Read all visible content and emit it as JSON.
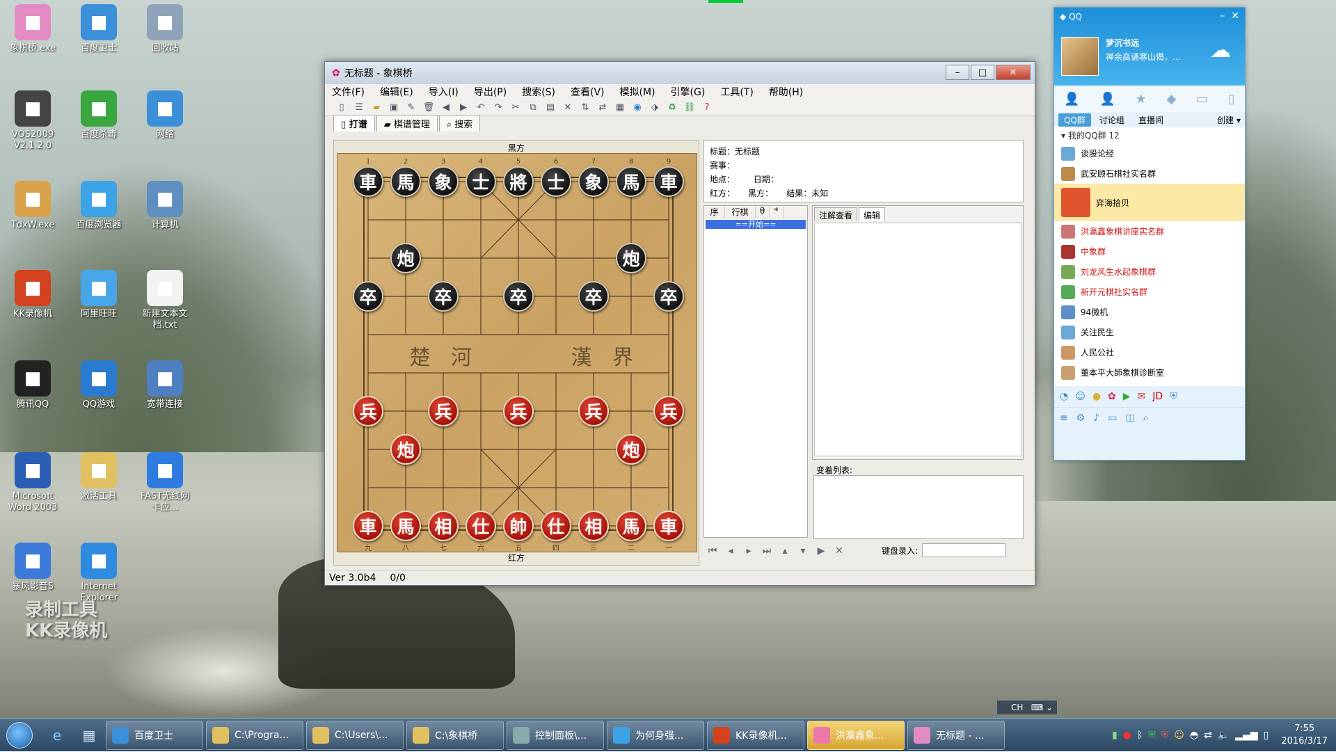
{
  "desktop": {
    "icons": [
      {
        "label": "象棋桥.exe",
        "icon": "cherry-blossom",
        "color": "#e58bc4"
      },
      {
        "label": "百度卫士",
        "icon": "shield",
        "color": "#3c8fd9"
      },
      {
        "label": "回收站",
        "icon": "recycle-bin",
        "color": "#8fa3b8"
      },
      {
        "label": "VOS2009\nV2.1.2.0",
        "icon": "vos",
        "color": "#444"
      },
      {
        "label": "百度杀毒",
        "icon": "shield-green",
        "color": "#3aa640"
      },
      {
        "label": "网络",
        "icon": "globe",
        "color": "#3c8fd9"
      },
      {
        "label": "TdxW.exe",
        "icon": "tdx",
        "color": "#d9a24a"
      },
      {
        "label": "百度浏览器",
        "icon": "browser",
        "color": "#3ba3e6"
      },
      {
        "label": "计算机",
        "icon": "computer",
        "color": "#5f8fc0"
      },
      {
        "label": "KK录像机",
        "icon": "kk",
        "color": "#d2421e"
      },
      {
        "label": "阿里旺旺",
        "icon": "wangwang",
        "color": "#48a6e8"
      },
      {
        "label": "新建文本文\n档.txt",
        "icon": "text-file",
        "color": "#f2f2f2"
      },
      {
        "label": "腾讯QQ",
        "icon": "penguin",
        "color": "#222"
      },
      {
        "label": "QQ游戏",
        "icon": "penguin-game",
        "color": "#2a7ad0"
      },
      {
        "label": "宽带连接",
        "icon": "network",
        "color": "#4e7fc0"
      },
      {
        "label": "Microsoft\nWord 2003",
        "icon": "word",
        "color": "#2a5eb5"
      },
      {
        "label": "激活工具",
        "icon": "folder",
        "color": "#e0c060"
      },
      {
        "label": "FAST无线网\n卡应...",
        "icon": "bars",
        "color": "#2f7be0"
      },
      {
        "label": "暴风影音5",
        "icon": "storm",
        "color": "#3b7ad8"
      },
      {
        "label": "Internet\nExplorer",
        "icon": "ie",
        "color": "#2f8be0"
      }
    ],
    "watermark": "录制工具\nKK录像机"
  },
  "window": {
    "title": "无标题 - 象棋桥",
    "menus": [
      "文件(F)",
      "编辑(E)",
      "导入(I)",
      "导出(P)",
      "搜索(S)",
      "查看(V)",
      "模拟(M)",
      "引擎(G)",
      "工具(T)",
      "帮助(H)"
    ],
    "tabs": [
      "打谱",
      "棋谱管理",
      "搜索"
    ],
    "board": {
      "top_label": "黑方",
      "bottom_label": "红方",
      "river_left": "楚 河",
      "river_right": "漢 界",
      "top_numbers": [
        "1",
        "2",
        "3",
        "4",
        "5",
        "6",
        "7",
        "8",
        "9"
      ],
      "bottom_numbers": [
        "九",
        "八",
        "七",
        "六",
        "五",
        "四",
        "三",
        "二",
        "一"
      ],
      "pieces": [
        {
          "c": 0,
          "r": 0,
          "t": "車",
          "s": "black"
        },
        {
          "c": 1,
          "r": 0,
          "t": "馬",
          "s": "black"
        },
        {
          "c": 2,
          "r": 0,
          "t": "象",
          "s": "black"
        },
        {
          "c": 3,
          "r": 0,
          "t": "士",
          "s": "black"
        },
        {
          "c": 4,
          "r": 0,
          "t": "將",
          "s": "black"
        },
        {
          "c": 5,
          "r": 0,
          "t": "士",
          "s": "black"
        },
        {
          "c": 6,
          "r": 0,
          "t": "象",
          "s": "black"
        },
        {
          "c": 7,
          "r": 0,
          "t": "馬",
          "s": "black"
        },
        {
          "c": 8,
          "r": 0,
          "t": "車",
          "s": "black"
        },
        {
          "c": 1,
          "r": 2,
          "t": "炮",
          "s": "black"
        },
        {
          "c": 7,
          "r": 2,
          "t": "炮",
          "s": "black"
        },
        {
          "c": 0,
          "r": 3,
          "t": "卒",
          "s": "black"
        },
        {
          "c": 2,
          "r": 3,
          "t": "卒",
          "s": "black"
        },
        {
          "c": 4,
          "r": 3,
          "t": "卒",
          "s": "black"
        },
        {
          "c": 6,
          "r": 3,
          "t": "卒",
          "s": "black"
        },
        {
          "c": 8,
          "r": 3,
          "t": "卒",
          "s": "black"
        },
        {
          "c": 0,
          "r": 6,
          "t": "兵",
          "s": "red"
        },
        {
          "c": 2,
          "r": 6,
          "t": "兵",
          "s": "red"
        },
        {
          "c": 4,
          "r": 6,
          "t": "兵",
          "s": "red"
        },
        {
          "c": 6,
          "r": 6,
          "t": "兵",
          "s": "red"
        },
        {
          "c": 8,
          "r": 6,
          "t": "兵",
          "s": "red"
        },
        {
          "c": 1,
          "r": 7,
          "t": "炮",
          "s": "red"
        },
        {
          "c": 7,
          "r": 7,
          "t": "炮",
          "s": "red"
        },
        {
          "c": 0,
          "r": 9,
          "t": "車",
          "s": "red"
        },
        {
          "c": 1,
          "r": 9,
          "t": "馬",
          "s": "red"
        },
        {
          "c": 2,
          "r": 9,
          "t": "相",
          "s": "red"
        },
        {
          "c": 3,
          "r": 9,
          "t": "仕",
          "s": "red"
        },
        {
          "c": 4,
          "r": 9,
          "t": "帥",
          "s": "red"
        },
        {
          "c": 5,
          "r": 9,
          "t": "仕",
          "s": "red"
        },
        {
          "c": 6,
          "r": 9,
          "t": "相",
          "s": "red"
        },
        {
          "c": 7,
          "r": 9,
          "t": "馬",
          "s": "red"
        },
        {
          "c": 8,
          "r": 9,
          "t": "車",
          "s": "red"
        }
      ]
    },
    "info": {
      "title": "标题：无标题",
      "event": "赛事：",
      "place": "地点：",
      "date": "日期：",
      "red": "红方：",
      "black": "黑方：",
      "result": "结果：未知"
    },
    "movelist": {
      "headers": [
        "序",
        "行棋",
        "θ",
        "*"
      ],
      "rows": [
        "==开始=="
      ]
    },
    "note_tabs": [
      "注解查看",
      "编辑"
    ],
    "variations_label": "变着列表:",
    "keyboard_label": "键盘录入:",
    "status": {
      "version": "Ver 3.0b4",
      "count": "0/0"
    }
  },
  "qq": {
    "title": "QQ",
    "nickname": "梦沉书远",
    "signature": "禅余高诵寒山偈，...",
    "tabs": [
      "QQ群",
      "讨论组",
      "直播间"
    ],
    "create": "创建",
    "group_header": "我的QQ群 12",
    "groups": [
      {
        "name": "谈股论经",
        "red": false,
        "color": "#6aa8d6"
      },
      {
        "name": "武安顾石棋社实名群",
        "red": false,
        "color": "#b98a4a"
      },
      {
        "name": "弈海拾贝",
        "red": false,
        "color": "#e0552d",
        "highlight": true
      },
      {
        "name": "洪瀛鑫象棋讲座实名群",
        "red": true,
        "color": "#c77"
      },
      {
        "name": "中象群",
        "red": true,
        "color": "#a33"
      },
      {
        "name": "刘龙风生水起象棋群",
        "red": true,
        "color": "#7a5"
      },
      {
        "name": "新开元棋社实名群",
        "red": true,
        "color": "#5a5"
      },
      {
        "name": "94微机",
        "red": false,
        "color": "#5c8ec9"
      },
      {
        "name": "关注民生",
        "red": false,
        "color": "#6aa8d6"
      },
      {
        "name": "人民公社",
        "red": false,
        "color": "#c96"
      },
      {
        "name": "董本平大師象棋诊断室",
        "red": false,
        "color": "#c9a070"
      }
    ]
  },
  "taskbar": {
    "tasks": [
      {
        "label": "百度卫士",
        "color": "#3c8fd9",
        "active": false
      },
      {
        "label": "C:\\Progra...",
        "color": "#e0c060",
        "active": false
      },
      {
        "label": "C:\\Users\\...",
        "color": "#e0c060",
        "active": false
      },
      {
        "label": "C:\\象棋桥",
        "color": "#e0c060",
        "active": false
      },
      {
        "label": "控制面板\\...",
        "color": "#8aa",
        "active": false
      },
      {
        "label": "为何身强...",
        "color": "#3ba3e6",
        "active": false
      },
      {
        "label": "KK录像机...",
        "color": "#d2421e",
        "active": false
      },
      {
        "label": "洪瀛鑫象...",
        "color": "#e7a",
        "active": true
      },
      {
        "label": "无标题 - ...",
        "color": "#e58bc4",
        "active": false
      }
    ],
    "lang": "CH",
    "time": "7:55",
    "date": "2016/3/17"
  }
}
